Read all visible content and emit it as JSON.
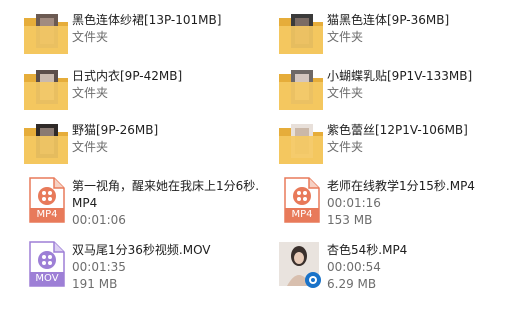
{
  "items": [
    {
      "name": "黑色连体纱裙[13P-101MB]",
      "type": "文件夹"
    },
    {
      "name": "猫黑色连体[9P-36MB]",
      "type": "文件夹"
    },
    {
      "name": "日式内衣[9P-42MB]",
      "type": "文件夹"
    },
    {
      "name": "小蝴蝶乳贴[9P1V-133MB]",
      "type": "文件夹"
    },
    {
      "name": "野猫[9P-26MB]",
      "type": "文件夹"
    },
    {
      "name": "紫色蕾丝[12P1V-106MB]",
      "type": "文件夹"
    },
    {
      "name_line1": "第一视角，醒来她在我床上1分6秒.",
      "name_line2": "MP4",
      "duration": "00:01:06",
      "badge": "MP4"
    },
    {
      "name": "老师在线教学1分15秒.MP4",
      "duration": "00:01:16",
      "size": "153 MB",
      "badge": "MP4"
    },
    {
      "name": "双马尾1分36秒视频.MOV",
      "duration": "00:01:35",
      "size": "191 MB",
      "badge": "MOV"
    },
    {
      "name": "杏色54秒.MP4",
      "duration": "00:00:54",
      "size": "6.29 MB"
    }
  ],
  "colors": {
    "folder": "#f5c963",
    "folder_dark": "#e6ad3a",
    "mp4_badge": "#e87a5a",
    "mov_badge": "#9d7fd6",
    "text_secondary": "#6d6d6d"
  }
}
